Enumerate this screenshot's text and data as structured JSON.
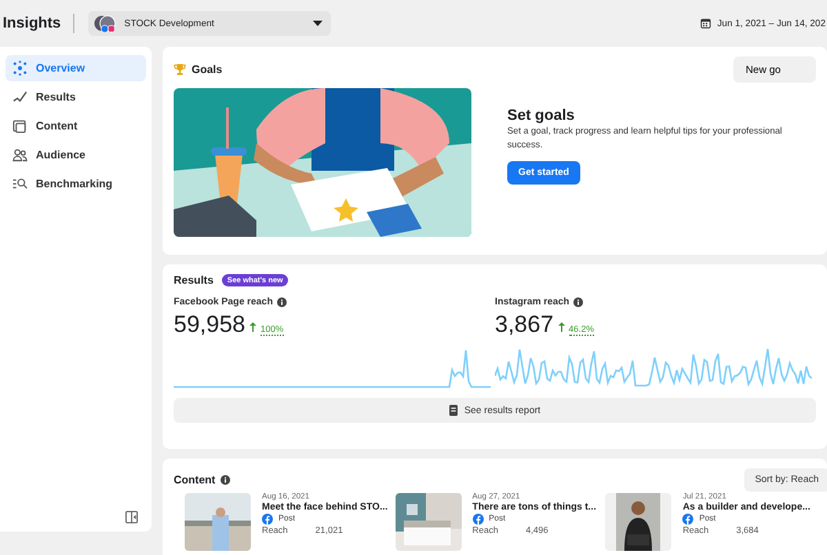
{
  "header": {
    "title": "Insights",
    "account": "STOCK Development",
    "date_range": "Jun 1, 2021 – Jun 14, 202"
  },
  "sidebar": {
    "items": [
      {
        "label": "Overview",
        "selected": true
      },
      {
        "label": "Results",
        "selected": false
      },
      {
        "label": "Content",
        "selected": false
      },
      {
        "label": "Audience",
        "selected": false
      },
      {
        "label": "Benchmarking",
        "selected": false
      }
    ]
  },
  "goals": {
    "title": "Goals",
    "new_button": "New go",
    "heading": "Set goals",
    "text": "Set a goal, track progress and learn helpful tips for your professional success.",
    "button": "Get started"
  },
  "results": {
    "title": "Results",
    "badge": "See what's new",
    "metrics": [
      {
        "label": "Facebook Page reach",
        "value": "59,958",
        "change": "100%"
      },
      {
        "label": "Instagram reach",
        "value": "3,867",
        "change": "46.2%"
      }
    ],
    "report_button": "See results report"
  },
  "content": {
    "title": "Content",
    "sort_button": "Sort by: Reach",
    "posts": [
      {
        "date": "Aug 16, 2021",
        "title": "Meet the face behind STO...",
        "type": "Post",
        "metric": "Reach",
        "value": "21,021"
      },
      {
        "date": "Aug 27, 2021",
        "title": "There are tons of things t...",
        "type": "Post",
        "metric": "Reach",
        "value": "4,496"
      },
      {
        "date": "Jul 21, 2021",
        "title": "As a builder and develope...",
        "type": "Post",
        "metric": "Reach",
        "value": "3,684"
      }
    ]
  }
}
